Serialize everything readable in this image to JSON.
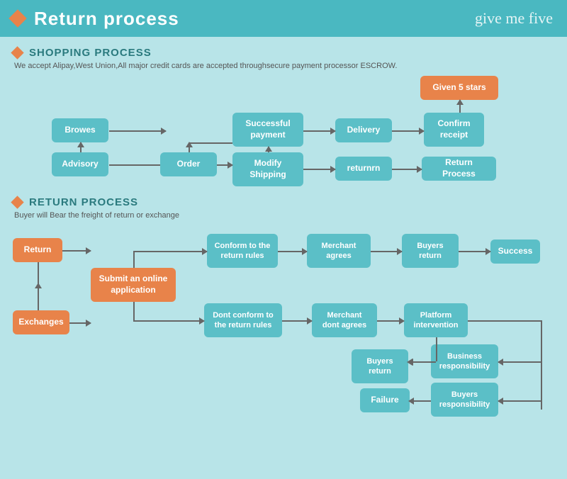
{
  "header": {
    "title": "Return process",
    "logo": "give me five"
  },
  "shopping": {
    "section_title": "SHOPPING PROCESS",
    "description": "We accept Alipay,West Union,All major credit cards are accepted throughsecure payment processor ESCROW.",
    "boxes": {
      "browes": "Browes",
      "order": "Order",
      "advisory": "Advisory",
      "modify_shipping": "Modify\nShipping",
      "successful_payment": "Successful\npayment",
      "delivery": "Delivery",
      "confirm_receipt": "Confirm\nreceipt",
      "given_5_stars": "Given 5 stars",
      "returnrn": "returnrn",
      "return_process": "Return Process"
    }
  },
  "return": {
    "section_title": "RETURN PROCESS",
    "description": "Buyer will Bear the freight of return or exchange",
    "boxes": {
      "return": "Return",
      "exchanges": "Exchanges",
      "submit_online": "Submit an online\napplication",
      "conform_return_rules": "Conform to the\nreturn rules",
      "dont_conform_return_rules": "Dont conform to the\nreturn rules",
      "merchant_agrees": "Merchant\nagrees",
      "merchant_dont_agrees": "Merchant\ndont agrees",
      "buyers_return_1": "Buyers\nreturn",
      "buyers_return_2": "Buyers\nreturn",
      "platform_intervention": "Platform\nintervention",
      "success": "Success",
      "business_responsibility": "Business\nresponsibility",
      "buyers_responsibility": "Buyers\nresponsibility",
      "failure": "Failure"
    }
  }
}
